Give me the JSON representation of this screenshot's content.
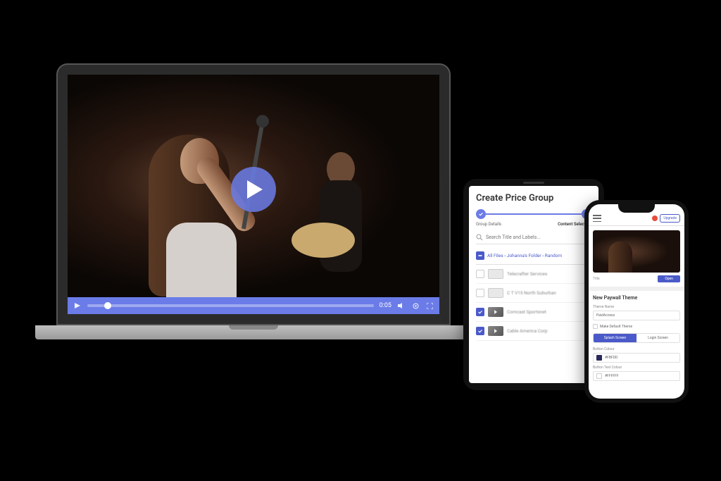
{
  "video_player": {
    "time_label": "0:05",
    "play_icon": "play-icon",
    "volume_icon": "volume-icon",
    "fullscreen_icon": "fullscreen-icon"
  },
  "tablet": {
    "title": "Create Price Group",
    "steps": {
      "step1_label": "Group Details",
      "step2_label": "Content Selection"
    },
    "search_placeholder": "Search Title and Labels...",
    "breadcrumb_parts": [
      "All Files",
      "Johanna's Folder",
      "Random"
    ],
    "breadcrumb": "All Files › Johanna's Folder › Random",
    "rows": [
      {
        "checked": false,
        "type": "folder",
        "label": "Telecrafter Services"
      },
      {
        "checked": false,
        "type": "folder",
        "label": "C T V15 North Suburban"
      },
      {
        "checked": true,
        "type": "video",
        "label": "Comcast Sportsnet"
      },
      {
        "checked": true,
        "type": "video",
        "label": "Cable America Corp"
      }
    ]
  },
  "phone": {
    "upgrade_label": "Upgrade",
    "preview_title": "Title",
    "preview_button": "Open",
    "section_title": "New Paywall Theme",
    "theme_name_label": "Theme Name",
    "theme_name_value": "PaidAccess",
    "default_checkbox": "Make Default Theme",
    "tabs": {
      "splash": "Splash Screen",
      "login": "Login Screen"
    },
    "button_colour_label": "Button Colour",
    "button_colour_value": "#FBFDD",
    "button_text_colour_label": "Button Text Colour",
    "button_text_colour_value": "#FFFFFF"
  },
  "colors": {
    "accent": "#6b7ce8",
    "accent_dark": "#4a5ac9"
  }
}
